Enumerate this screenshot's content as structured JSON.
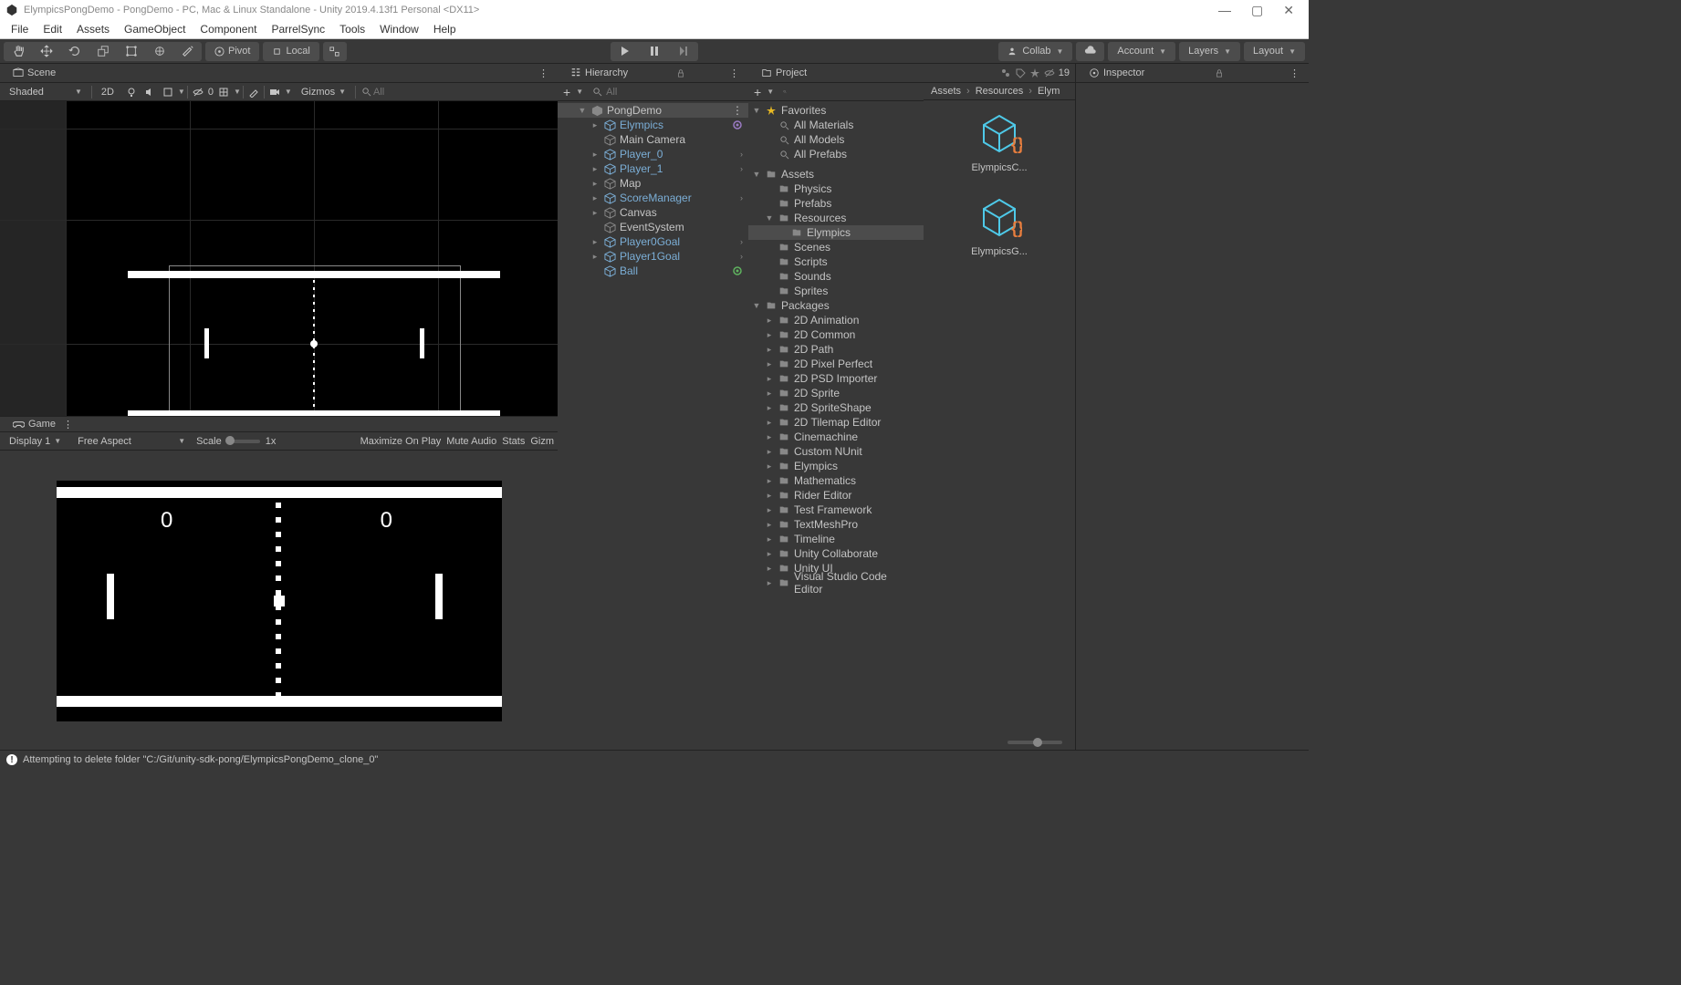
{
  "window": {
    "title": "ElympicsPongDemo - PongDemo - PC, Mac & Linux Standalone - Unity 2019.4.13f1 Personal <DX11>"
  },
  "menubar": [
    "File",
    "Edit",
    "Assets",
    "GameObject",
    "Component",
    "ParrelSync",
    "Tools",
    "Window",
    "Help"
  ],
  "toolbar": {
    "pivot": "Pivot",
    "local": "Local",
    "collab": "Collab",
    "account": "Account",
    "layers": "Layers",
    "layout": "Layout"
  },
  "scene_panel": {
    "title": "Scene",
    "shading": "Shaded",
    "mode2d": "2D",
    "hidden_count": "0",
    "gizmos": "Gizmos",
    "search_placeholder": "All"
  },
  "game_panel": {
    "title": "Game",
    "display": "Display 1",
    "aspect": "Free Aspect",
    "scale_label": "Scale",
    "scale_value": "1x",
    "maximize": "Maximize On Play",
    "mute": "Mute Audio",
    "stats": "Stats",
    "gizm": "Gizm",
    "score_left": "0",
    "score_right": "0"
  },
  "hierarchy": {
    "title": "Hierarchy",
    "search_placeholder": "All",
    "scene": "PongDemo",
    "items": [
      {
        "label": "Elympics",
        "prefab": true,
        "expand": true,
        "badge": "gear"
      },
      {
        "label": "Main Camera",
        "prefab": false
      },
      {
        "label": "Player_0",
        "prefab": true,
        "expand": true,
        "chev": true
      },
      {
        "label": "Player_1",
        "prefab": true,
        "expand": true,
        "chev": true
      },
      {
        "label": "Map",
        "prefab": false,
        "expand": true
      },
      {
        "label": "ScoreManager",
        "prefab": true,
        "expand": true,
        "chev": true
      },
      {
        "label": "Canvas",
        "prefab": false,
        "expand": true
      },
      {
        "label": "EventSystem",
        "prefab": false
      },
      {
        "label": "Player0Goal",
        "prefab": true,
        "expand": true,
        "chev": true
      },
      {
        "label": "Player1Goal",
        "prefab": true,
        "expand": true,
        "chev": true
      },
      {
        "label": "Ball",
        "prefab": true,
        "badge": "green"
      }
    ]
  },
  "project": {
    "title": "Project",
    "hidden_label": "19",
    "favorites": {
      "label": "Favorites",
      "items": [
        "All Materials",
        "All Models",
        "All Prefabs"
      ]
    },
    "assets": {
      "label": "Assets",
      "items": [
        "Physics",
        "Prefabs"
      ],
      "resources": {
        "label": "Resources",
        "items": [
          "Elympics"
        ]
      },
      "rest": [
        "Scenes",
        "Scripts",
        "Sounds",
        "Sprites"
      ]
    },
    "packages": {
      "label": "Packages",
      "items": [
        "2D Animation",
        "2D Common",
        "2D Path",
        "2D Pixel Perfect",
        "2D PSD Importer",
        "2D Sprite",
        "2D SpriteShape",
        "2D Tilemap Editor",
        "Cinemachine",
        "Custom NUnit",
        "Elympics",
        "Mathematics",
        "Rider Editor",
        "Test Framework",
        "TextMeshPro",
        "Timeline",
        "Unity Collaborate",
        "Unity UI",
        "Visual Studio Code Editor"
      ]
    },
    "breadcrumb": [
      "Assets",
      "Resources",
      "Elym"
    ],
    "grid_items": [
      "ElympicsC...",
      "ElympicsG..."
    ]
  },
  "inspector": {
    "title": "Inspector"
  },
  "statusbar": {
    "message": "Attempting to delete folder \"C:/Git/unity-sdk-pong/ElympicsPongDemo_clone_0\""
  }
}
